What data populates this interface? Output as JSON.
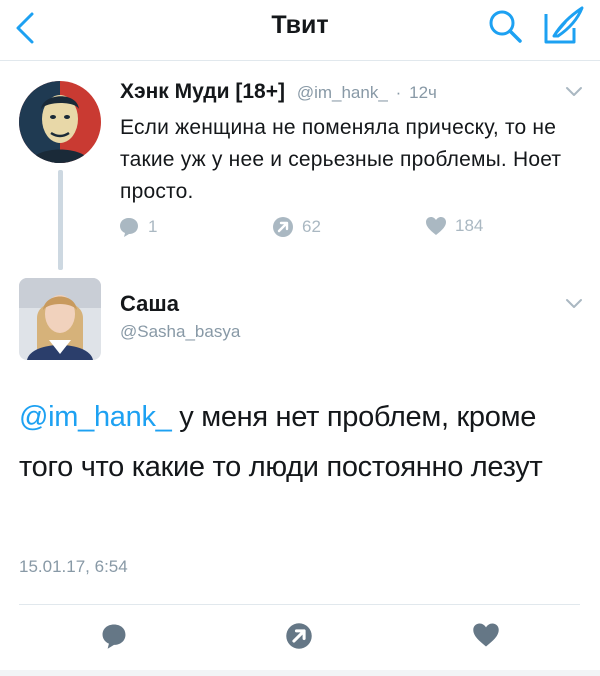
{
  "header": {
    "title": "Твит",
    "back_icon": "chevron-left-icon",
    "search_icon": "search-icon",
    "compose_icon": "compose-icon",
    "accent": "#1da1f2"
  },
  "tweet": {
    "author_name": "Хэнк Муди [18+]",
    "author_handle": "@im_hank_",
    "separator": "·",
    "time": "12ч",
    "text": "Если женщина не поменяла прическу, то не такие уж у нее и серьезные проблемы. Ноет просто.",
    "replies": "1",
    "retweets": "62",
    "likes": "184"
  },
  "reply": {
    "author_name": "Саша",
    "author_handle": "@Sasha_basya",
    "mention": "@im_hank_",
    "text": " у меня нет проблем, кроме того что какие то люди постоянно лезут",
    "date": "15.01.17, 6:54"
  },
  "colors": {
    "muted": "#8899a6",
    "icon_gray": "#aab8c2",
    "icon_dark": "#657786",
    "thread_line": "#cdd8e1"
  }
}
